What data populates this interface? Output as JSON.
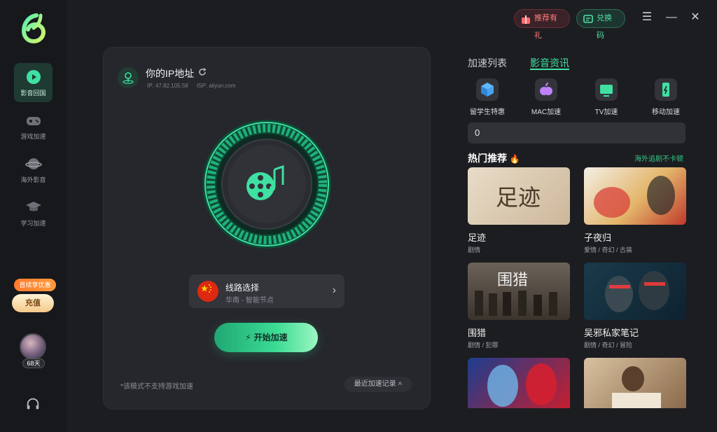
{
  "sidebar": {
    "items": [
      {
        "label": "影音回国",
        "icon": "play-icon",
        "active": true
      },
      {
        "label": "游戏加速",
        "icon": "gamepad-icon",
        "active": false
      },
      {
        "label": "海外影音",
        "icon": "planet-icon",
        "active": false
      },
      {
        "label": "学习加速",
        "icon": "graduation-cap-icon",
        "active": false
      }
    ],
    "promo_badge": "首续享优惠",
    "recharge_label": "充值",
    "days_badge": "68天"
  },
  "topbar": {
    "recommend_label": "推荐有礼",
    "redeem_label": "兑换码",
    "menu_glyph": "☰",
    "minimize_glyph": "—",
    "close_glyph": "✕"
  },
  "ip_panel": {
    "title": "你的IP地址",
    "ip": "IP: 47.82.105.58",
    "isp": "ISP: aliyun.com"
  },
  "route": {
    "title": "线路选择",
    "subtitle": "华南 - 智能节点",
    "chevron": "›"
  },
  "start_button": "开始加速",
  "note": "*该模式不支持游戏加速",
  "recent_records": "最近加速记录 ˄",
  "right_panel": {
    "tabs": [
      "加速列表",
      "影音资讯"
    ],
    "categories": [
      {
        "label": "留学生特惠",
        "icon": "cube-icon"
      },
      {
        "label": "MAC加速",
        "icon": "apple-icon"
      },
      {
        "label": "TV加速",
        "icon": "tv-icon"
      },
      {
        "label": "移动加速",
        "icon": "phone-battery-icon"
      }
    ],
    "search_value": "0",
    "hot_title": "热门推荐",
    "hot_more": "海外追剧不卡顿",
    "posters": [
      {
        "title": "足迹",
        "tags": "剧情",
        "poster_text": "足迹"
      },
      {
        "title": "子夜归",
        "tags": "爱情 / 奇幻 / 古装"
      },
      {
        "title": "围猎",
        "tags": "剧情 / 犯罪",
        "poster_text": "围猎"
      },
      {
        "title": "吴邪私家笔记",
        "tags": "剧情 / 奇幻 / 冒险"
      }
    ]
  },
  "colors": {
    "accent": "#3fe0a1",
    "background": "#1c1d21",
    "card": "#26272c"
  }
}
